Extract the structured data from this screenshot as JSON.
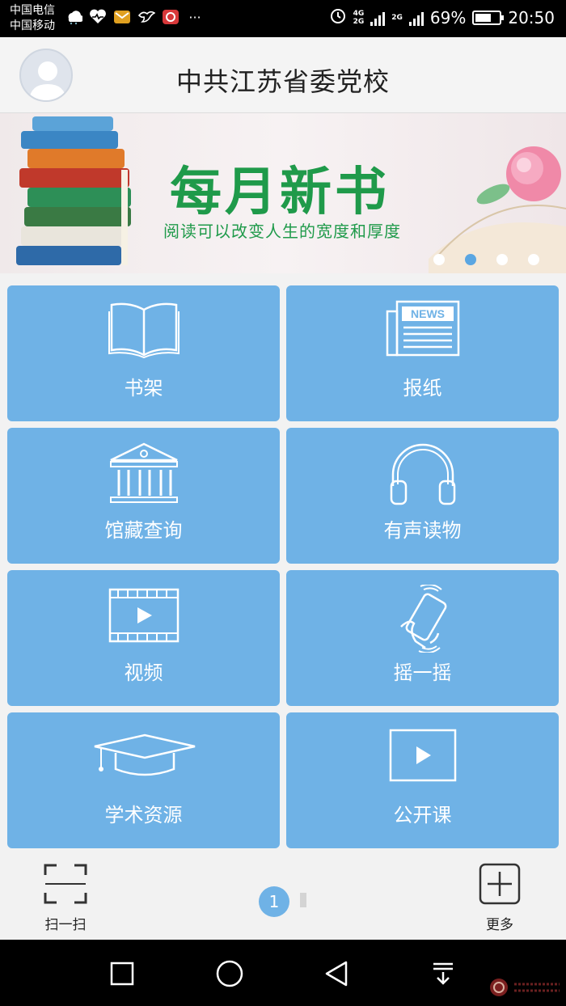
{
  "status_bar": {
    "carrier1": "中国电信",
    "carrier2": "中国移动",
    "net1": "4G",
    "net2": "2G",
    "net3": "2G",
    "battery_percent": "69%",
    "battery_level": 0.69,
    "time": "20:50",
    "overflow": "···"
  },
  "header": {
    "title": "中共江苏省委党校"
  },
  "banner": {
    "title": "每月新书",
    "subtitle": "阅读可以改变人生的宽度和厚度",
    "slide_count": 4,
    "active_slide": 2
  },
  "tiles": [
    {
      "label": "书架",
      "icon": "open-book-icon"
    },
    {
      "label": "报纸",
      "icon": "newspaper-icon",
      "icon_text": "NEWS"
    },
    {
      "label": "馆藏查询",
      "icon": "library-building-icon"
    },
    {
      "label": "有声读物",
      "icon": "headphones-icon"
    },
    {
      "label": "视频",
      "icon": "video-film-icon"
    },
    {
      "label": "摇一摇",
      "icon": "shake-phone-icon"
    },
    {
      "label": "学术资源",
      "icon": "graduation-cap-icon"
    },
    {
      "label": "公开课",
      "icon": "play-screen-icon"
    }
  ],
  "bottom_bar": {
    "scan_label": "扫一扫",
    "page_number": "1",
    "more_label": "更多"
  },
  "colors": {
    "tile": "#6fb2e6",
    "banner_green": "#1f9a4a",
    "active_dot": "#5aa6e2"
  }
}
